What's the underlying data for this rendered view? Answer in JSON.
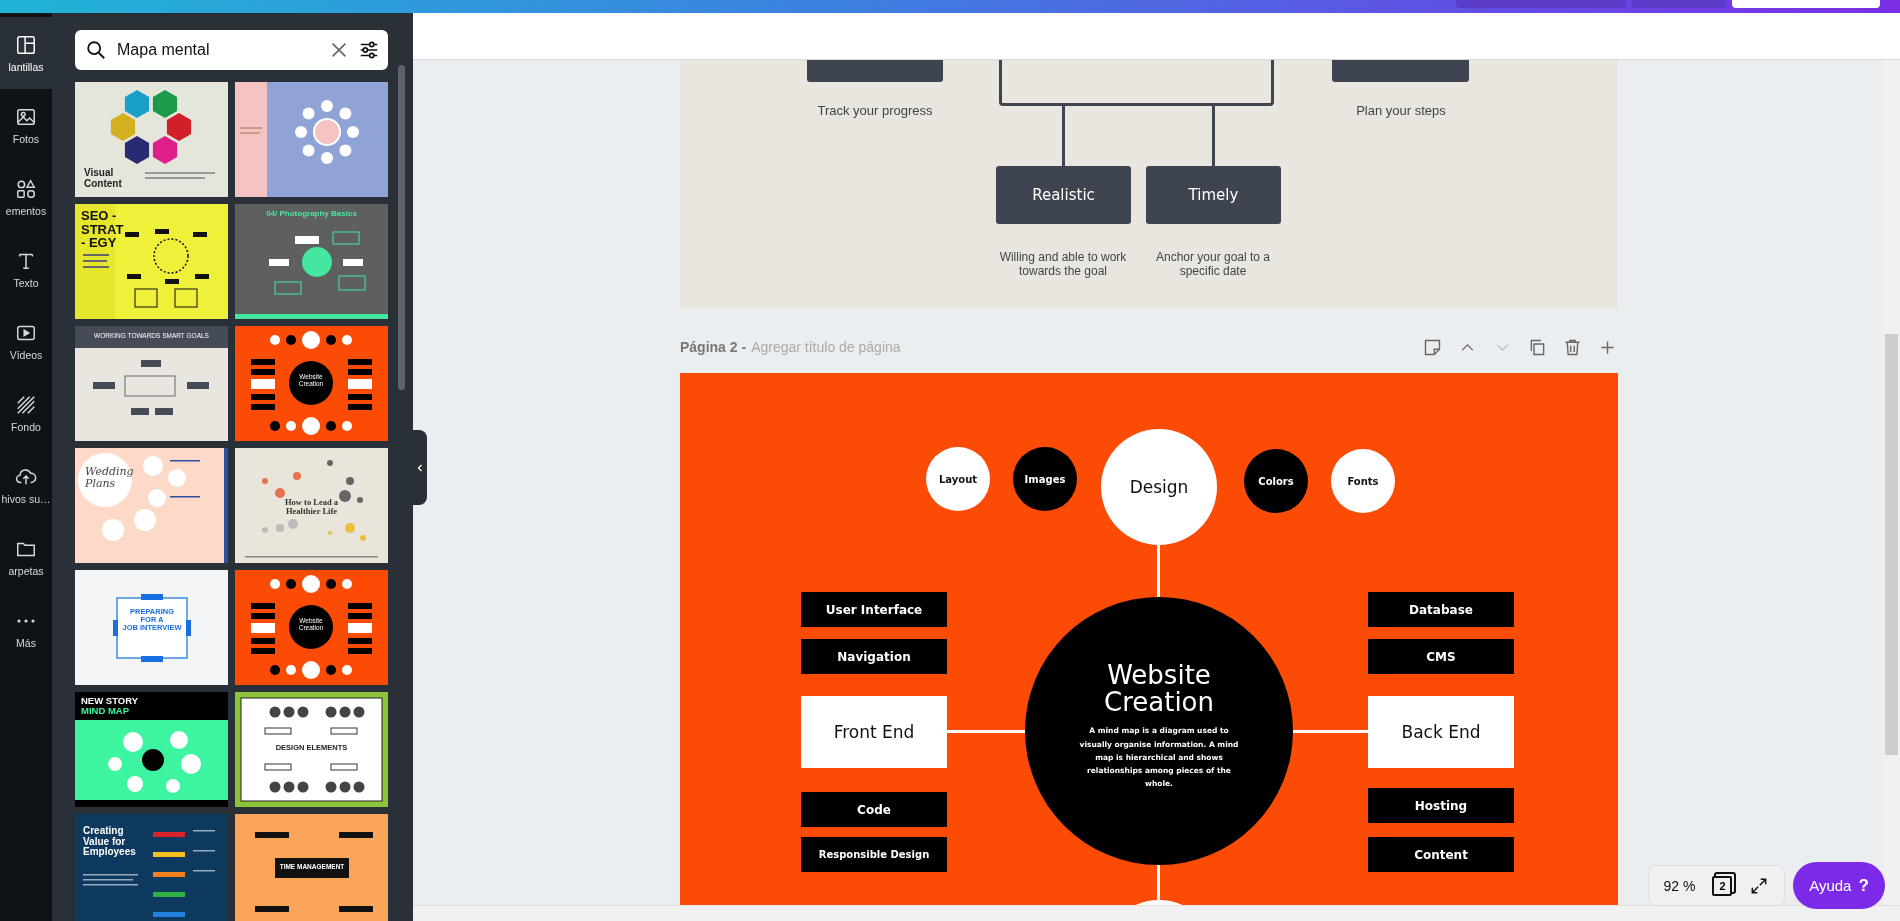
{
  "top_bar": {
    "buttons": [
      {
        "kind": "dark"
      },
      {
        "kind": "dark"
      },
      {
        "kind": "light"
      }
    ]
  },
  "rail": {
    "items": [
      {
        "kind": "templates",
        "label": "lantillas",
        "selected": true
      },
      {
        "kind": "photos",
        "label": "Fotos",
        "selected": false
      },
      {
        "kind": "elements",
        "label": "ementos",
        "selected": false
      },
      {
        "kind": "text",
        "label": "Texto",
        "selected": false
      },
      {
        "kind": "videos",
        "label": "Vídeos",
        "selected": false
      },
      {
        "kind": "background",
        "label": "Fondo",
        "selected": false
      },
      {
        "kind": "uploads",
        "label": "hivos su…",
        "selected": false
      },
      {
        "kind": "folders",
        "label": "arpetas",
        "selected": false
      },
      {
        "kind": "more",
        "label": "Más",
        "selected": false
      }
    ]
  },
  "panel": {
    "search": {
      "value": "Mapa mental"
    },
    "templates": [
      {
        "kind": "hexagons",
        "title_lines": [
          "Visual",
          "Content"
        ]
      },
      {
        "kind": "bubbles"
      },
      {
        "kind": "seo",
        "title_lines": [
          "SEO -",
          "STRAT",
          "- EGY"
        ]
      },
      {
        "kind": "photography",
        "title_lines": [
          "04/ Photography Basics"
        ]
      },
      {
        "kind": "smart",
        "title_lines": [
          "WORKING TOWARDS SMART GOALS"
        ]
      },
      {
        "kind": "website",
        "title_lines": [
          "Website",
          "Creation"
        ]
      },
      {
        "kind": "wedding",
        "title_lines": [
          "Wedding",
          "Plans"
        ]
      },
      {
        "kind": "healthier",
        "title_lines": [
          "How to Lead a",
          "Healthier Life"
        ]
      },
      {
        "kind": "interview",
        "title_lines": [
          "PREPARING",
          "FOR A",
          "JOB INTERVIEW"
        ]
      },
      {
        "kind": "website",
        "title_lines": [
          "Website",
          "Creation"
        ]
      },
      {
        "kind": "newstory",
        "title_lines": [
          "NEW STORY",
          "MIND MAP"
        ]
      },
      {
        "kind": "design",
        "title_lines": [
          "DESIGN ELEMENTS"
        ]
      },
      {
        "kind": "value",
        "title_lines": [
          "Creating",
          "Value for",
          "Employees"
        ]
      },
      {
        "kind": "time",
        "title_lines": [
          "TIME MANAGEMENT"
        ]
      }
    ]
  },
  "page_1": {
    "side_notes": [
      "Track your progress",
      "Plan your steps"
    ],
    "boxes": [
      {
        "label": "Realistic",
        "note": "Willing and able to work towards the goal"
      },
      {
        "label": "Timely",
        "note": "Anchor your goal to a specific date"
      }
    ]
  },
  "page_2": {
    "number": "Página 2 -",
    "title_placeholder": "Agregar título de página",
    "actions": [
      {
        "kind": "note",
        "disabled": false
      },
      {
        "kind": "up",
        "disabled": false
      },
      {
        "kind": "down",
        "disabled": true
      },
      {
        "kind": "copy",
        "disabled": false
      },
      {
        "kind": "trash",
        "disabled": false
      },
      {
        "kind": "add",
        "disabled": false
      }
    ],
    "mind_map": {
      "title": "Website Creation",
      "description": "A mind map is a diagram used to visually organise information. A mind map is hierarchical and shows relationships among pieces of the whole.",
      "top_branch": {
        "label": "Design",
        "subtopics": [
          {
            "label": "Layout",
            "kind": "light"
          },
          {
            "label": "Images",
            "kind": "dark"
          },
          {
            "label": "Colors",
            "kind": "dark"
          },
          {
            "label": "Fonts",
            "kind": "light"
          }
        ]
      },
      "left_branch": {
        "label": "Front End",
        "subtopics": [
          "User Interface",
          "Navigation",
          "Code",
          "Responsible Design"
        ]
      },
      "right_branch": {
        "label": "Back End",
        "subtopics": [
          "Database",
          "CMS",
          "Hosting",
          "Content"
        ]
      }
    }
  },
  "zoom": "92 %",
  "page_count": "2",
  "help_button": {
    "label": "Ayuda",
    "glyph": "?"
  }
}
